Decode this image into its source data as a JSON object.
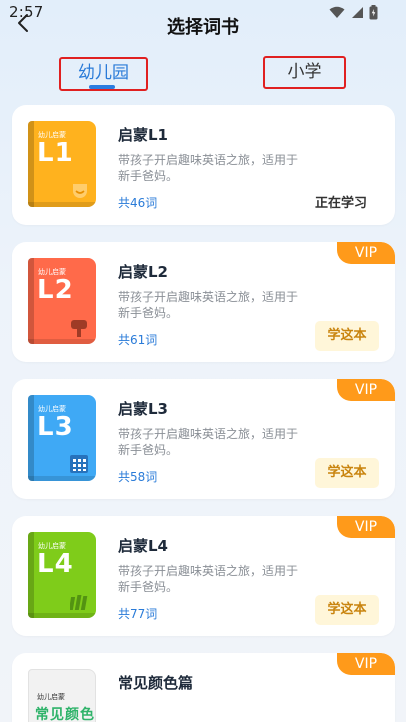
{
  "status_bar": {
    "time": "2:57"
  },
  "header": {
    "title": "选择词书"
  },
  "tabs": [
    {
      "label": "幼儿园",
      "active": true
    },
    {
      "label": "小学",
      "active": false
    }
  ],
  "colors": {
    "accent": "#2a7bd8",
    "vip": "#ff9a1a",
    "learn_button_bg": "#fff6d9",
    "learn_button_text": "#c9840e"
  },
  "cards": [
    {
      "title": "启蒙L1",
      "desc": "带孩子开启趣味英语之旅，适用于新手爸妈。",
      "count": "共46词",
      "status": "正在学习",
      "cover_series": "幼儿启蒙",
      "cover_level": "L1",
      "cover_color": "#ffb21e",
      "cover_icon": "smile-icon"
    },
    {
      "title": "启蒙L2",
      "desc": "带孩子开启趣味英语之旅，适用于新手爸妈。",
      "count": "共61词",
      "button": "学这本",
      "badge": "VIP",
      "cover_series": "幼儿启蒙",
      "cover_level": "L2",
      "cover_color": "#ff6a4a",
      "cover_icon": "mailbox-icon"
    },
    {
      "title": "启蒙L3",
      "desc": "带孩子开启趣味英语之旅，适用于新手爸妈。",
      "count": "共58词",
      "button": "学这本",
      "badge": "VIP",
      "cover_series": "幼儿启蒙",
      "cover_level": "L3",
      "cover_color": "#3fa9f5",
      "cover_icon": "calculator-icon"
    },
    {
      "title": "启蒙L4",
      "desc": "带孩子开启趣味英语之旅，适用于新手爸妈。",
      "count": "共77词",
      "button": "学这本",
      "badge": "VIP",
      "cover_series": "幼儿启蒙",
      "cover_level": "L4",
      "cover_color": "#7fcc1a",
      "cover_icon": "books-icon"
    },
    {
      "title": "常见颜色篇",
      "badge": "VIP",
      "cover_series": "幼儿启蒙",
      "cover_level": "常见颜色",
      "cover_color": "#f2f2f2",
      "cover_icon": ""
    }
  ]
}
